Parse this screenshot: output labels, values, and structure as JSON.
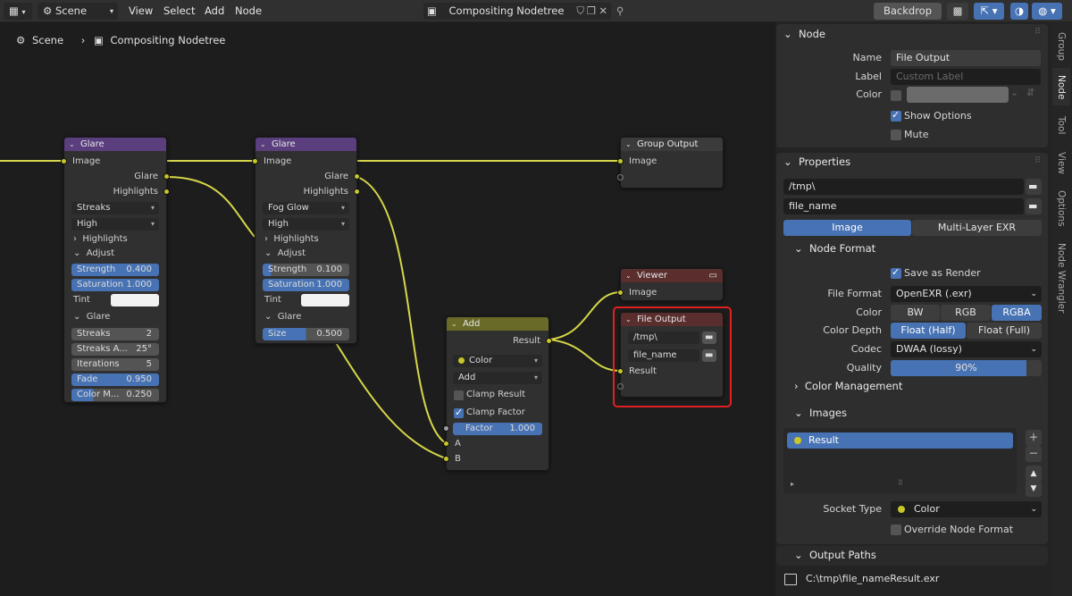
{
  "header": {
    "scene": "Scene",
    "menus": [
      "View",
      "Select",
      "Add",
      "Node"
    ],
    "nodetree": "Compositing Nodetree",
    "backdrop": "Backdrop"
  },
  "breadcrumb": {
    "scene": "Scene",
    "tree": "Compositing Nodetree"
  },
  "nodes": {
    "glare1": {
      "title": "Glare",
      "image": "Image",
      "glare": "Glare",
      "highlights": "Highlights",
      "type": "Streaks",
      "quality": "High",
      "highlights_panel": "Highlights",
      "adjust": "Adjust",
      "strength_l": "Strength",
      "strength_v": "0.400",
      "saturation_l": "Saturation",
      "saturation_v": "1.000",
      "tint": "Tint",
      "glare_panel": "Glare",
      "streaks_l": "Streaks",
      "streaks_v": "2",
      "angle_l": "Streaks A...",
      "angle_v": "25°",
      "iter_l": "Iterations",
      "iter_v": "5",
      "fade_l": "Fade",
      "fade_v": "0.950",
      "colormod_l": "Color M...",
      "colormod_v": "0.250"
    },
    "glare2": {
      "title": "Glare",
      "image": "Image",
      "glare": "Glare",
      "highlights": "Highlights",
      "type": "Fog Glow",
      "quality": "High",
      "highlights_panel": "Highlights",
      "adjust": "Adjust",
      "strength_l": "Strength",
      "strength_v": "0.100",
      "saturation_l": "Saturation",
      "saturation_v": "1.000",
      "tint": "Tint",
      "glare_panel": "Glare",
      "size_l": "Size",
      "size_v": "0.500"
    },
    "group_output": {
      "title": "Group Output",
      "image": "Image"
    },
    "viewer": {
      "title": "Viewer",
      "image": "Image"
    },
    "add": {
      "title": "Add",
      "result": "Result",
      "datatype": "Color",
      "operation": "Add",
      "clamp_result": "Clamp Result",
      "clamp_factor": "Clamp Factor",
      "factor_l": "Factor",
      "factor_v": "1.000",
      "a": "A",
      "b": "B"
    },
    "file_output": {
      "title": "File Output",
      "path": "/tmp\\",
      "filename": "file_name",
      "result": "Result"
    }
  },
  "sidebar_tabs": [
    "Group",
    "Node",
    "Tool",
    "View",
    "Options",
    "Node Wrangler"
  ],
  "node_panel": {
    "title": "Node",
    "name_label": "Name",
    "name_value": "File Output",
    "label_label": "Label",
    "label_placeholder": "Custom Label",
    "color_label": "Color",
    "show_options": "Show Options",
    "mute": "Mute"
  },
  "properties": {
    "title": "Properties",
    "directory": "/tmp\\",
    "filename": "file_name",
    "tab_image": "Image",
    "tab_exr": "Multi-Layer EXR",
    "node_format": "Node Format",
    "save_as_render": "Save as Render",
    "file_format_l": "File Format",
    "file_format_v": "OpenEXR (.exr)",
    "color_l": "Color",
    "color_opts": [
      "BW",
      "RGB",
      "RGBA"
    ],
    "depth_l": "Color Depth",
    "depth_opts": [
      "Float (Half)",
      "Float (Full)"
    ],
    "codec_l": "Codec",
    "codec_v": "DWAA (lossy)",
    "quality_l": "Quality",
    "quality_v": "90%",
    "quality": 0.9,
    "color_mgmt": "Color Management",
    "images": "Images",
    "image_item": "Result",
    "socket_l": "Socket Type",
    "socket_v": "Color",
    "override": "Override Node Format",
    "output_paths": "Output Paths",
    "path": "C:\\tmp\\file_nameResult.exr"
  },
  "colors": {
    "accent": "#4772b3",
    "wire": "#d6d64a",
    "highlight": "#e02020"
  }
}
